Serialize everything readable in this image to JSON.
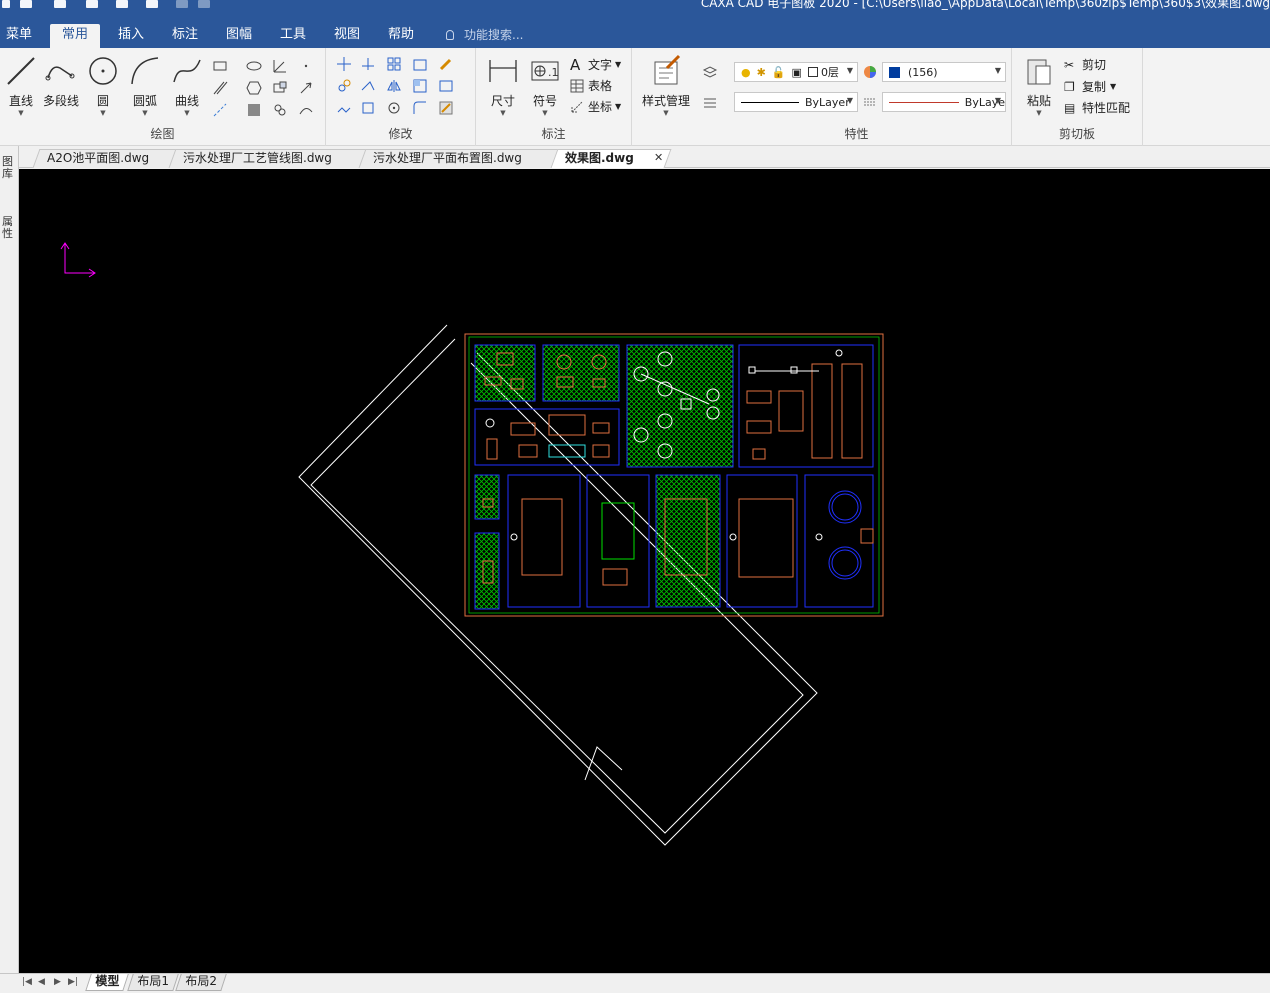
{
  "app": {
    "title": "CAXA CAD 电子图板 2020 - [C:\\Users\\liao_\\AppData\\Local\\Temp\\360zip$Temp\\360$3\\效果图.dwg"
  },
  "menu_tabs": [
    "菜单",
    "常用",
    "插入",
    "标注",
    "图幅",
    "工具",
    "视图",
    "帮助"
  ],
  "active_tab": "常用",
  "search_label": "功能搜索...",
  "ribbon": {
    "draw": {
      "label": "绘图",
      "buttons": [
        "直线",
        "多段线",
        "圆",
        "圆弧",
        "曲线"
      ]
    },
    "modify": {
      "label": "修改"
    },
    "annotate": {
      "label": "标注",
      "buttons": [
        "尺寸",
        "符号"
      ],
      "small": [
        "文字",
        "表格",
        "坐标"
      ]
    },
    "style": {
      "button": "样式管理"
    },
    "properties": {
      "label": "特性",
      "layer": "0层",
      "color": "(156)",
      "linetype": "ByLayer",
      "lineweight": "ByLaye"
    },
    "clipboard": {
      "label": "剪切板",
      "paste": "粘贴",
      "cut": "剪切",
      "copy": "复制",
      "match": "特性匹配"
    }
  },
  "doc_tabs": [
    "A2O池平面图.dwg",
    "污水处理厂工艺管线图.dwg",
    "污水处理厂平面布置图.dwg",
    "效果图.dwg"
  ],
  "active_doc": "效果图.dwg",
  "side_panel": [
    "图库",
    "属性"
  ],
  "layout_tabs": [
    "模型",
    "布局1",
    "布局2"
  ],
  "active_layout": "模型",
  "colors": {
    "titlebar": "#2b579a",
    "canvas": "#000000",
    "ucs": "#ff00ff",
    "hatch": "#00c000",
    "boundary": "#e07040",
    "blue_lines": "#2030ff",
    "white_lines": "#ffffff"
  }
}
